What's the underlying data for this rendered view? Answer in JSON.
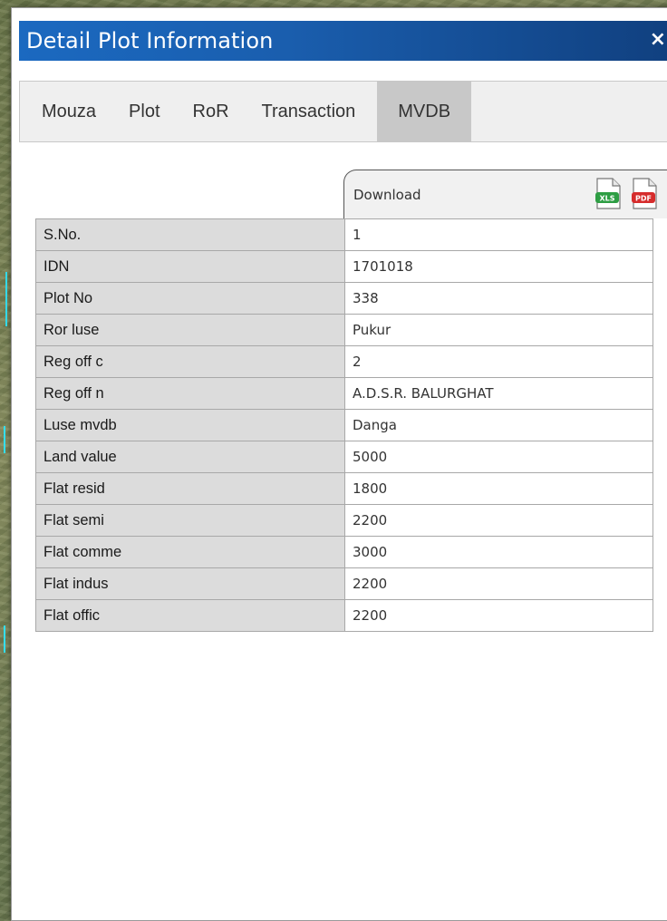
{
  "dialog": {
    "title": "Detail Plot Information",
    "close_label": "×"
  },
  "tabs": [
    {
      "label": "Mouza",
      "active": false
    },
    {
      "label": "Plot",
      "active": false
    },
    {
      "label": "RoR",
      "active": false
    },
    {
      "label": "Transaction",
      "active": false
    },
    {
      "label": "MVDB",
      "active": true
    }
  ],
  "download": {
    "label": "Download",
    "icons": [
      {
        "name": "xls-file-icon",
        "text": "XLS",
        "color": "#2e9e44"
      },
      {
        "name": "pdf-file-icon",
        "text": "PDF",
        "color": "#d62c2c"
      }
    ]
  },
  "rows": [
    {
      "label": "S.No.",
      "value": "1"
    },
    {
      "label": "IDN",
      "value": "1701018"
    },
    {
      "label": "Plot No",
      "value": "338"
    },
    {
      "label": "Ror luse",
      "value": "Pukur"
    },
    {
      "label": "Reg off c",
      "value": "2"
    },
    {
      "label": "Reg off n",
      "value": "A.D.S.R. BALURGHAT"
    },
    {
      "label": "Luse mvdb",
      "value": "Danga"
    },
    {
      "label": "Land value",
      "value": "5000"
    },
    {
      "label": "Flat resid",
      "value": "1800"
    },
    {
      "label": "Flat semi",
      "value": "2200"
    },
    {
      "label": "Flat comme",
      "value": "3000"
    },
    {
      "label": "Flat indus",
      "value": "2200"
    },
    {
      "label": "Flat offic",
      "value": "2200"
    }
  ],
  "colors": {
    "title_bar_start": "#1b69c0",
    "title_bar_end": "#103f7e",
    "active_tab": "#c8c8c8",
    "label_cell": "#dcdcdc"
  }
}
